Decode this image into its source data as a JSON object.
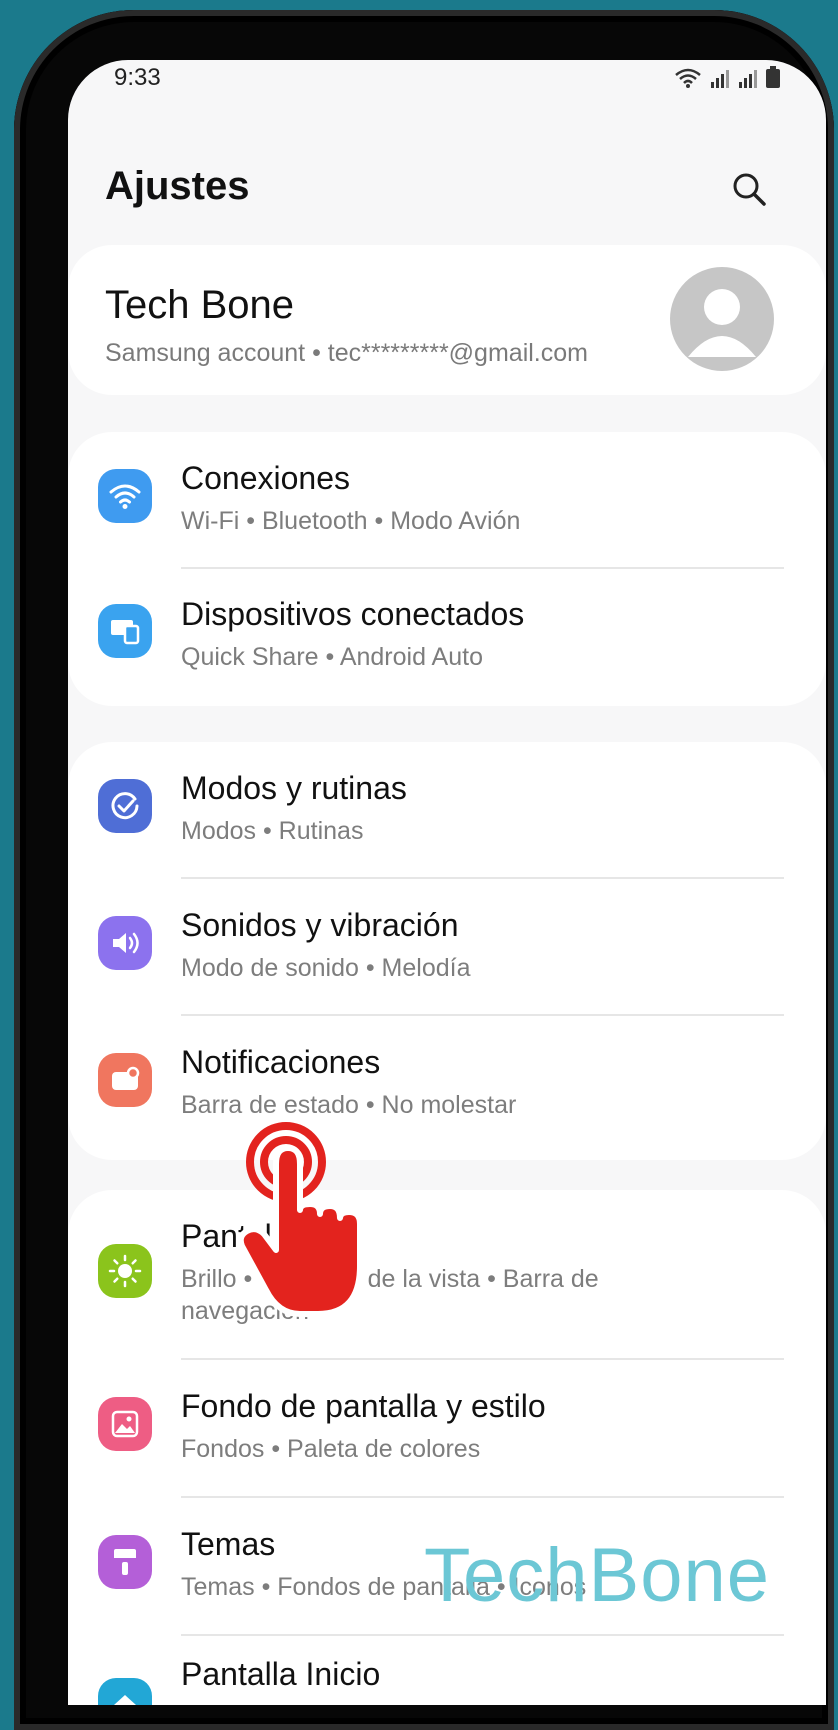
{
  "status_bar": {
    "time": "9:33"
  },
  "header": {
    "title": "Ajustes",
    "search_icon": "search-icon"
  },
  "account": {
    "name": "Tech Bone",
    "subtitle": "Samsung account  •  tec*********@gmail.com"
  },
  "groups": [
    {
      "items": [
        {
          "title": "Conexiones",
          "subtitle": "Wi-Fi  •  Bluetooth  •  Modo Avión",
          "icon": "wifi-icon",
          "color": "#3f9bf0"
        },
        {
          "title": "Dispositivos conectados",
          "subtitle": "Quick Share  •  Android Auto",
          "icon": "devices-icon",
          "color": "#3aa3ef"
        }
      ]
    },
    {
      "items": [
        {
          "title": "Modos y rutinas",
          "subtitle": "Modos  •  Rutinas",
          "icon": "check-circle-icon",
          "color": "#4f6ed6"
        },
        {
          "title": "Sonidos y vibración",
          "subtitle": "Modo de sonido  •  Melodía",
          "icon": "speaker-icon",
          "color": "#8c72ee"
        },
        {
          "title": "Notificaciones",
          "subtitle": "Barra de estado  •  No molestar",
          "icon": "notification-icon",
          "color": "#f0765f"
        }
      ]
    },
    {
      "items": [
        {
          "title": "Pantalla",
          "subtitle_line1": "Brillo  •  Protector de la vista  •  Barra de",
          "subtitle_line2": "navegación",
          "icon": "sun-icon",
          "color": "#8bc41c"
        },
        {
          "title": "Fondo de pantalla y estilo",
          "subtitle": "Fondos  •  Paleta de colores",
          "icon": "image-icon",
          "color": "#ee5d84"
        },
        {
          "title": "Temas",
          "subtitle": "Temas  •  Fondos de pantalla  •  Iconos",
          "icon": "paint-brush-icon",
          "color": "#b45fd8"
        },
        {
          "title": "Pantalla Inicio",
          "icon": "home-icon",
          "color": "#22a7d6"
        }
      ]
    }
  ],
  "watermark": "TechBone"
}
